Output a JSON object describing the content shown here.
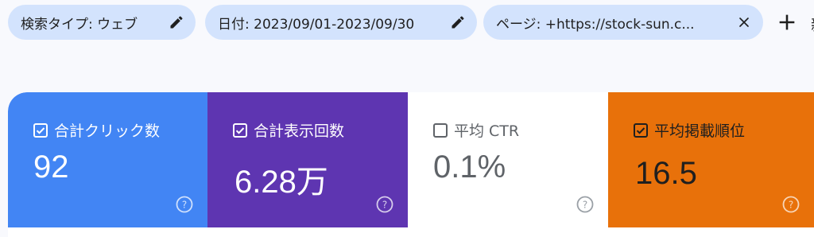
{
  "filters": [
    {
      "label": "検索タイプ: ウェブ",
      "icon": "pencil-icon"
    },
    {
      "label": "日付: 2023/09/01-2023/09/30",
      "icon": "pencil-icon"
    },
    {
      "label": "ページ: +https://stock-sun.c...",
      "icon": "close-icon"
    }
  ],
  "add_filter": {
    "label": "新",
    "icon": "plus-icon"
  },
  "metrics": [
    {
      "label": "合計クリック数",
      "value": "92",
      "checked": true,
      "color": "#4285f4"
    },
    {
      "label": "合計表示回数",
      "value": "6.28万",
      "checked": true,
      "color": "#5e35b1"
    },
    {
      "label": "平均 CTR",
      "value": "0.1%",
      "checked": false,
      "color": "#ffffff"
    },
    {
      "label": "平均掲載順位",
      "value": "16.5",
      "checked": true,
      "color": "#e8710a"
    }
  ]
}
